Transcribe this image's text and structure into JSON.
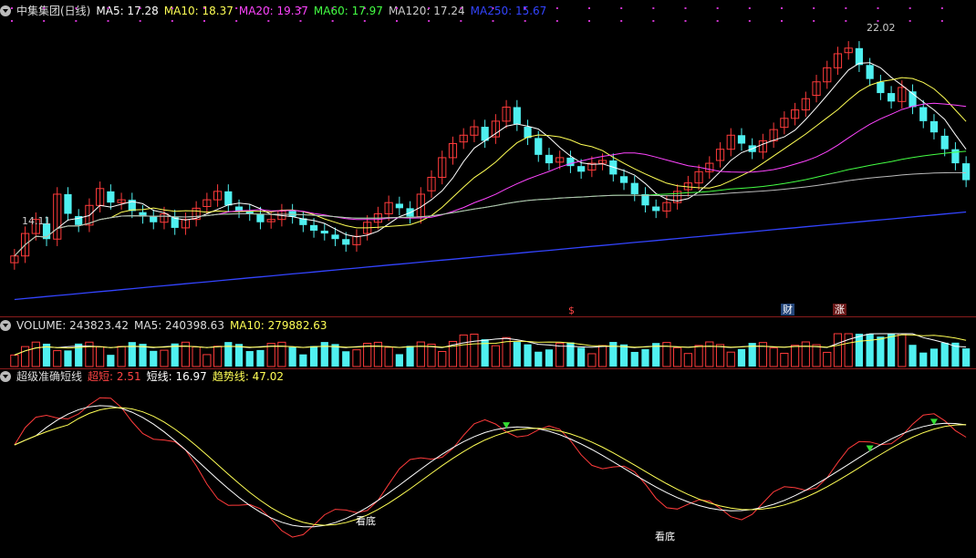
{
  "main_header": {
    "title": "中集集团(日线)",
    "ma5": "MA5: 17.28",
    "ma10": "MA10: 18.37",
    "ma20": "MA20: 19.37",
    "ma60": "MA60: 17.97",
    "ma120": "MA120: 17.24",
    "ma250": "MA250: 15.67"
  },
  "price_labels": {
    "high": "22.02",
    "low": "14.11"
  },
  "markers": {
    "dollar": "$",
    "finance": "财",
    "rise": "涨"
  },
  "volume_header": {
    "volume": "VOLUME: 243823.42",
    "ma5": "MA5: 240398.63",
    "ma10": "MA10: 279882.63"
  },
  "indicator_header": {
    "name": "超级准确短线",
    "super_short": "超短: 2.51",
    "short_line": "短线: 16.97",
    "trend_line": "趋势线: 47.02"
  },
  "indicator_labels": {
    "bottom1": "看底",
    "bottom2": "看底"
  },
  "colors": {
    "up": "#ff3b3b",
    "down": "#4ff0f0",
    "ma5": "#ffffff",
    "ma10": "#ffff55",
    "ma20": "#ff44ff",
    "ma60": "#44ff44",
    "ma120": "#bbbbbb",
    "ma250": "#3344ff",
    "separator": "#8a1c1c"
  },
  "chart_data": {
    "type": "candlestick",
    "closes": [
      14.6,
      15.4,
      15.9,
      15.2,
      16.8,
      16.1,
      15.7,
      16.4,
      17.0,
      16.5,
      16.6,
      16.2,
      16.0,
      15.8,
      16.1,
      15.6,
      15.9,
      16.3,
      16.6,
      16.9,
      16.4,
      16.2,
      16.1,
      15.8,
      15.9,
      16.2,
      16.0,
      15.7,
      15.5,
      15.4,
      15.2,
      15.0,
      15.3,
      15.8,
      16.1,
      16.5,
      16.3,
      16.0,
      16.8,
      17.4,
      18.1,
      18.6,
      18.9,
      19.2,
      18.7,
      19.4,
      19.9,
      19.3,
      18.8,
      18.2,
      17.9,
      18.1,
      17.8,
      17.6,
      17.9,
      18.0,
      17.5,
      17.2,
      16.8,
      16.4,
      16.2,
      16.5,
      16.9,
      17.2,
      17.6,
      17.9,
      18.4,
      18.9,
      18.6,
      18.3,
      18.7,
      19.1,
      19.5,
      19.8,
      20.2,
      20.8,
      21.3,
      21.8,
      22.0,
      21.4,
      20.9,
      20.4,
      20.1,
      20.6,
      19.9,
      19.4,
      19.0,
      18.4,
      17.9,
      17.3
    ],
    "volume_series": [
      {
        "name": "VOLUME"
      },
      {
        "name": "MA5"
      },
      {
        "name": "MA10"
      }
    ],
    "indicator_series": [
      {
        "name": "超短"
      },
      {
        "name": "短线"
      },
      {
        "name": "趋势线"
      }
    ]
  }
}
